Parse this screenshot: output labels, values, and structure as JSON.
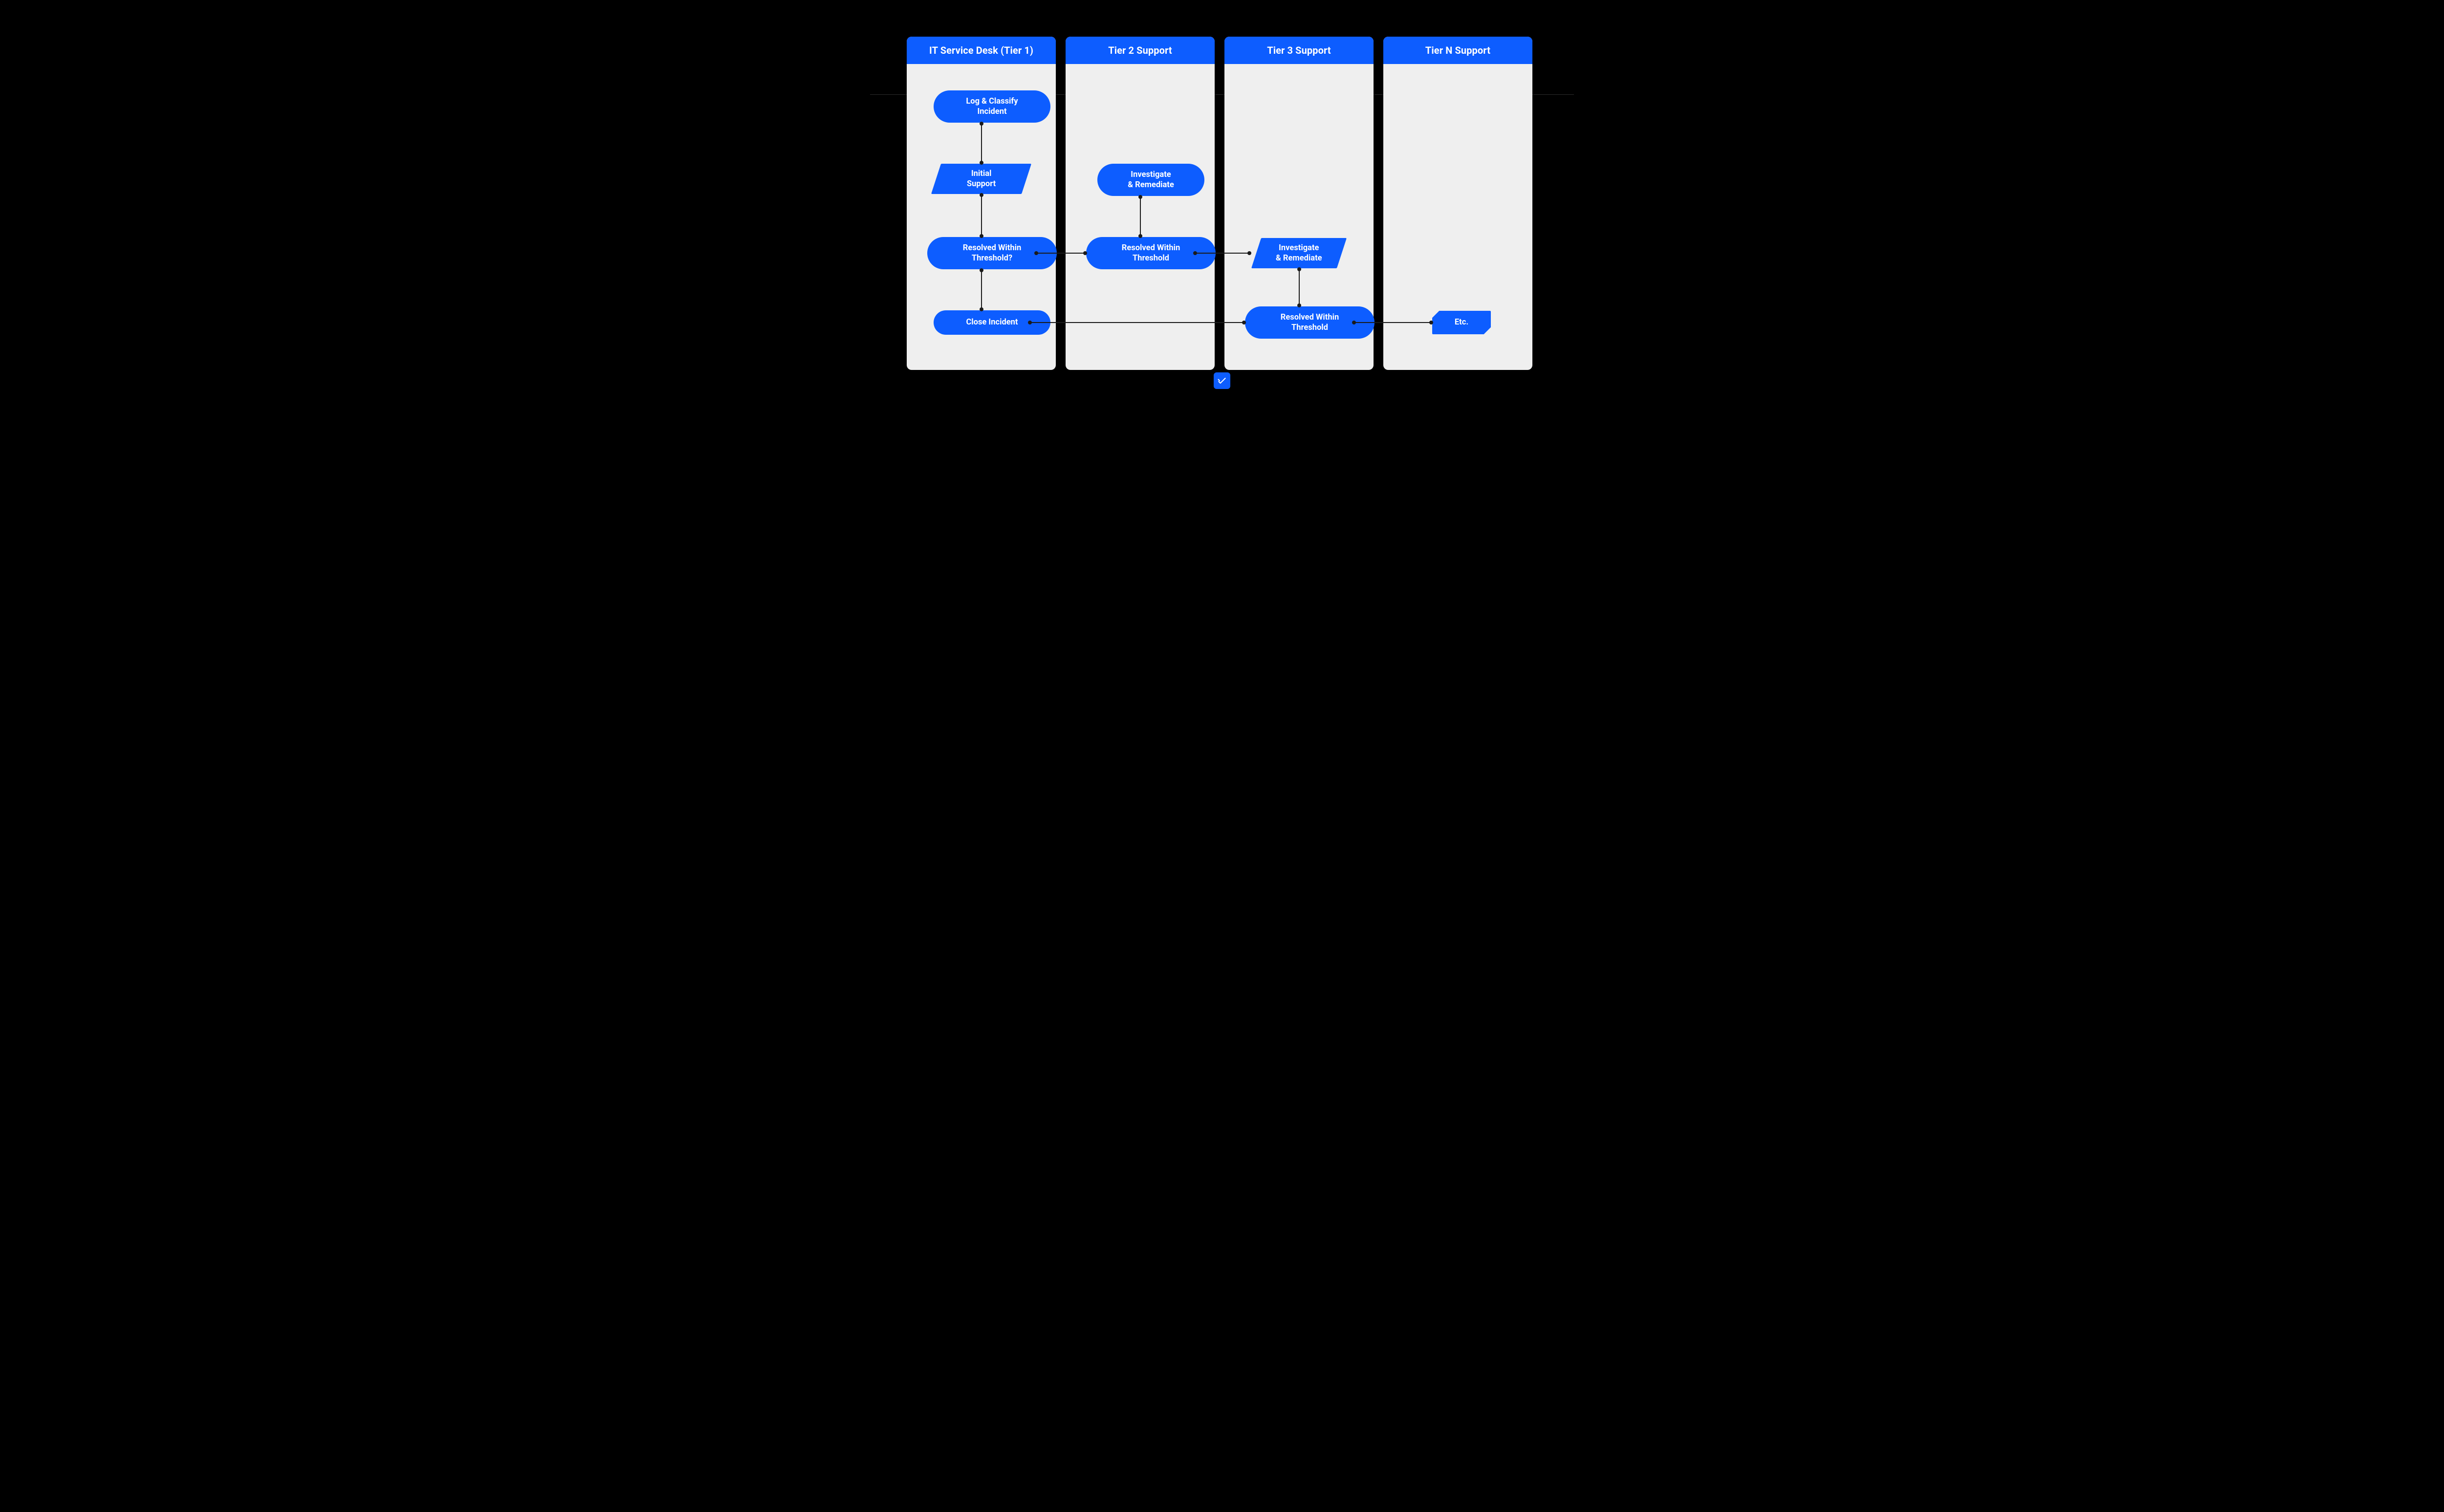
{
  "colors": {
    "accent": "#0d5dff",
    "lane_bg": "#efefef",
    "page_bg": "#000000"
  },
  "lanes": [
    {
      "id": "tier1",
      "title": "IT Service Desk (Tier 1)"
    },
    {
      "id": "tier2",
      "title": "Tier 2 Support"
    },
    {
      "id": "tier3",
      "title": "Tier 3 Support"
    },
    {
      "id": "tierN",
      "title": "Tier N Support"
    }
  ],
  "nodes": {
    "log_classify": {
      "line1": "Log & Classify",
      "line2": "Incident"
    },
    "initial_support": {
      "line1": "Initial",
      "line2": "Support"
    },
    "resolved_q": {
      "line1": "Resolved Within",
      "line2": "Threshold?"
    },
    "close_incident": {
      "line1": "Close Incident"
    },
    "t2_investigate": {
      "line1": "Investigate",
      "line2": "& Remediate"
    },
    "t2_resolved": {
      "line1": "Resolved Within",
      "line2": "Threshold"
    },
    "t3_investigate": {
      "line1": "Investigate",
      "line2": "& Remediate"
    },
    "t3_resolved": {
      "line1": "Resolved Within",
      "line2": "Threshold"
    },
    "etc": {
      "line1": "Etc."
    }
  },
  "brand": {
    "name": "brand-logo"
  }
}
